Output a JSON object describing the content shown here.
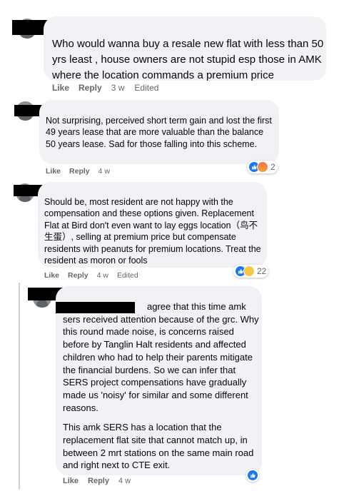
{
  "comments": [
    {
      "text": "Who would wanna buy a resale new flat with less than 50 yrs least , house owners are not stupid esp those in AMK where the location commands a premium price",
      "like": "Like",
      "reply": "Reply",
      "time": "3 w",
      "edited": "Edited"
    },
    {
      "text": "Not surprising, perceived short term gain and lost the first 49 years lease that are more valuable than the balance 50 years lease. Sad for those falling into this scheme.",
      "like": "Like",
      "reply": "Reply",
      "time": "4 w",
      "reactions": {
        "icons": [
          "like-icon",
          "angry-icon"
        ],
        "count": "2"
      }
    },
    {
      "text": "Should be, most resident are not happy with the compensation and these options given. Replacement Flat at Bird don't even want to lay eggs location（鸟不生蛋）, selling at premium price but compensate residents with peanuts for premium locations. Treat the resident as moron or fools",
      "like": "Like",
      "reply": "Reply",
      "time": "4 w",
      "edited": "Edited",
      "reactions": {
        "icons": [
          "like-icon",
          "sad-icon"
        ],
        "count": "22"
      }
    },
    {
      "para1_first": "agree that this time amk",
      "para1_rest": "sers received attention because of the grc. Why this round made noise, is concerns raised before by Tanglin Halt residents and affected children who had to help their parents mitigate the financial burdens. So we can infer that SERS project compensations have gradually made us 'noisy' for similar and some different reasons.",
      "para2": "This amk SERS has a location that the replacement flat site that cannot match up, in between 2 mrt stations on the same main road and right next to CTE exit.",
      "like": "Like",
      "reply": "Reply",
      "time": "4 w",
      "reactions": {
        "icons": [
          "like-icon"
        ]
      }
    }
  ],
  "colors": {
    "bubble": "#f0f2f5",
    "meta": "#65676b",
    "like_blue": "#1877f2",
    "text": "#050505"
  }
}
